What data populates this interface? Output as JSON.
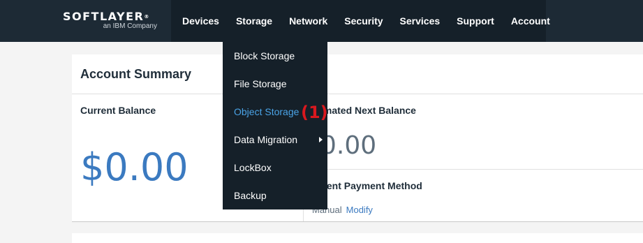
{
  "brand": {
    "name": "SOFTLAYER",
    "mark": "®",
    "tagline": "an IBM Company"
  },
  "nav": [
    "Devices",
    "Storage",
    "Network",
    "Security",
    "Services",
    "Support",
    "Account"
  ],
  "storage_menu": {
    "items": [
      "Block Storage",
      "File Storage",
      "Object Storage",
      "Data Migration",
      "LockBox",
      "Backup"
    ],
    "active_item": "Object Storage"
  },
  "annotation": "(1)",
  "summary": {
    "title": "Account Summary",
    "current_balance_label": "Current Balance",
    "current_balance_value": "$0.00",
    "next_balance_label_visible": "imated Next Balance",
    "next_balance_value_visible": "0.00",
    "payment_label_visible": "rrent Payment Method",
    "payment_value_visible": "Manual",
    "modify_label": "Modify"
  },
  "colors": {
    "nav_bg": "#1d2a35",
    "menu_bg": "#152029",
    "accent": "#3b7ac0",
    "active_link": "#4aa3e6",
    "marker": "#d9181e"
  }
}
